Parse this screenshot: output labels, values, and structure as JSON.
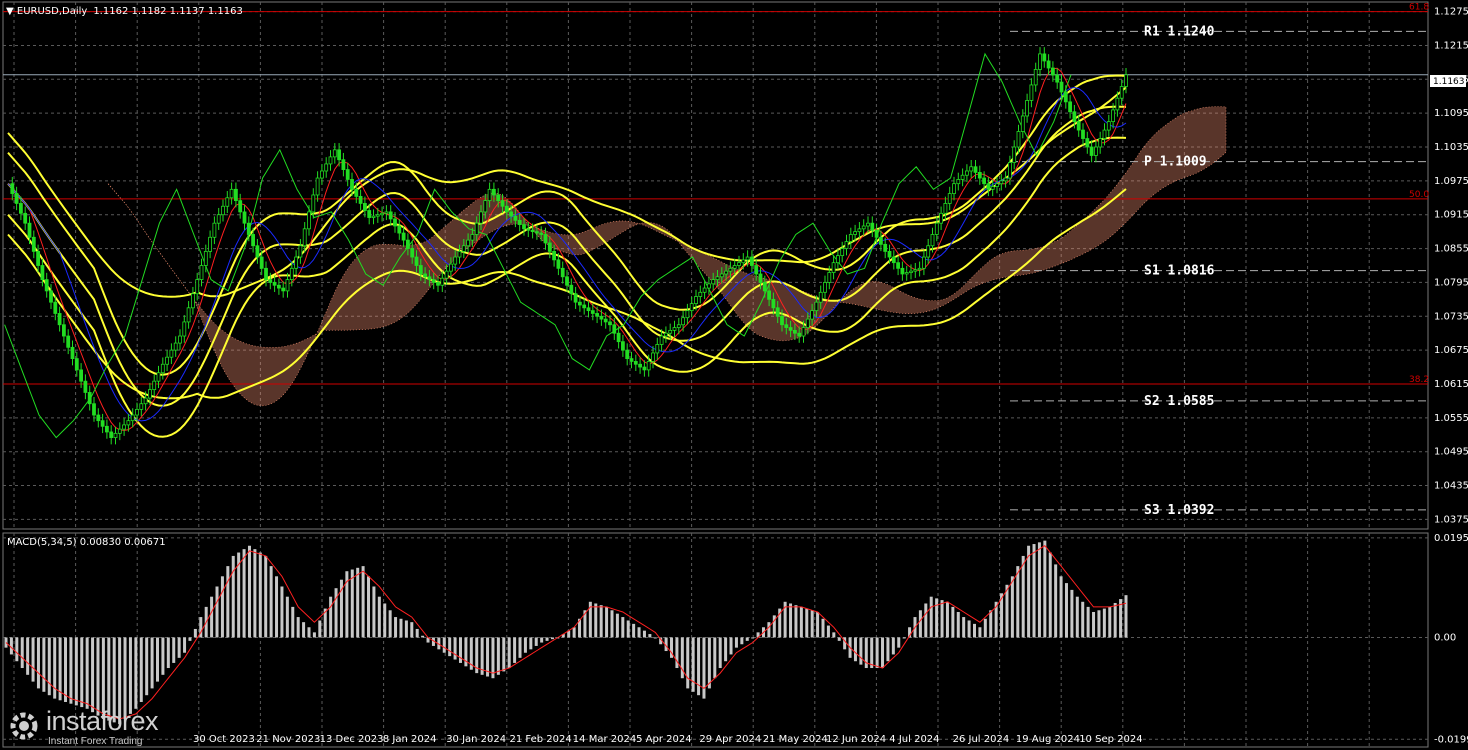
{
  "header": {
    "symbol": "EURUSD,Daily",
    "ohlc": "1.1162 1.1182 1.1137 1.1163",
    "current_price": "1.1163"
  },
  "macd": {
    "label": "MACD(5,34,5) 0.00830 0.00671"
  },
  "pivots": [
    {
      "label": "R1",
      "value": "1.1240"
    },
    {
      "label": "P",
      "value": "1.1009"
    },
    {
      "label": "S1",
      "value": "1.0816"
    },
    {
      "label": "S2",
      "value": "1.0585"
    },
    {
      "label": "S3",
      "value": "1.0392"
    }
  ],
  "fibo": [
    {
      "label": "61.8",
      "value": 1.1275
    },
    {
      "label": "50.0",
      "value": 1.0943
    },
    {
      "label": "38.2",
      "value": 1.0615
    }
  ],
  "logo": {
    "brand": "instaforex",
    "tagline": "Instant Forex Trading"
  },
  "colors": {
    "background": "#000000",
    "candles": "#22dd22",
    "bollinger": "#ffff33",
    "tenkan": "#ff2020",
    "kijun": "#1a2aff",
    "chikou": "#22dd22",
    "cloud": "#ff9977",
    "fibo_line": "#d00000",
    "macd_hist": "#c8c8c8",
    "macd_signal": "#ff2020",
    "grid": "#5a5a5a"
  },
  "chart_data": [
    {
      "type": "line",
      "title": "EURUSD,Daily",
      "y_ticks": [
        "1.1275",
        "1.1215",
        "1.1155",
        "1.1095",
        "1.1035",
        "1.0975",
        "1.0915",
        "1.0855",
        "1.0795",
        "1.0735",
        "1.0675",
        "1.0615",
        "1.0555",
        "1.0495",
        "1.0435",
        "1.0375"
      ],
      "x_ticks": [
        "30 Oct 2023",
        "21 Nov 2023",
        "13 Dec 2023",
        "8 Jan 2024",
        "30 Jan 2024",
        "21 Feb 2024",
        "14 Mar 2024",
        "5 Apr 2024",
        "29 Apr 2024",
        "21 May 2024",
        "12 Jun 2024",
        "4 Jul 2024",
        "26 Jul 2024",
        "19 Aug 2024",
        "10 Sep 2024"
      ],
      "ylim": [
        1.0358,
        1.1292
      ],
      "grid": true,
      "series": [
        {
          "name": "EURUSD",
          "values": [
            1.097,
            1.09,
            1.08,
            1.072,
            1.064,
            1.056,
            1.052,
            1.055,
            1.059,
            1.065,
            1.07,
            1.08,
            1.09,
            1.096,
            1.088,
            1.08,
            1.078,
            1.086,
            1.098,
            1.103,
            1.096,
            1.091,
            1.092,
            1.087,
            1.081,
            1.079,
            1.084,
            1.088,
            1.096,
            1.092,
            1.089,
            1.088,
            1.082,
            1.076,
            1.074,
            1.072,
            1.066,
            1.064,
            1.07,
            1.072,
            1.077,
            1.08,
            1.082,
            1.084,
            1.078,
            1.072,
            1.07,
            1.076,
            1.083,
            1.088,
            1.09,
            1.085,
            1.081,
            1.082,
            1.09,
            1.097,
            1.1,
            1.096,
            1.098,
            1.109,
            1.12,
            1.115,
            1.108,
            1.102,
            1.108,
            1.1163
          ]
        }
      ]
    },
    {
      "type": "bar",
      "title": "MACD(5,34,5) 0.00830 0.00671",
      "y_ticks": [
        "0.01955",
        "0.00",
        "-0.01998"
      ],
      "ylim": [
        -0.0215,
        0.0205
      ],
      "series": [
        {
          "name": "MACD",
          "values": [
            -0.002,
            -0.006,
            -0.01,
            -0.012,
            -0.013,
            -0.014,
            -0.016,
            -0.017,
            -0.014,
            -0.01,
            -0.006,
            -0.003,
            0.004,
            0.01,
            0.016,
            0.018,
            0.016,
            0.01,
            0.004,
            0.001,
            0.008,
            0.013,
            0.014,
            0.008,
            0.004,
            0.003,
            -0.001,
            -0.003,
            -0.005,
            -0.007,
            -0.008,
            -0.006,
            -0.003,
            -0.001,
            0.0,
            0.002,
            0.007,
            0.006,
            0.004,
            0.002,
            0.0,
            -0.004,
            -0.01,
            -0.012,
            -0.006,
            -0.002,
            0.0,
            0.003,
            0.007,
            0.006,
            0.005,
            0.001,
            -0.004,
            -0.006,
            -0.006,
            -0.002,
            0.004,
            0.008,
            0.007,
            0.004,
            0.002,
            0.007,
            0.012,
            0.018,
            0.019,
            0.012,
            0.008,
            0.005,
            0.006,
            0.0083
          ]
        },
        {
          "name": "Signal",
          "values": [
            -0.001,
            -0.004,
            -0.007,
            -0.01,
            -0.012,
            -0.013,
            -0.015,
            -0.016,
            -0.015,
            -0.012,
            -0.008,
            -0.004,
            0.001,
            0.007,
            0.013,
            0.017,
            0.016,
            0.012,
            0.006,
            0.003,
            0.006,
            0.011,
            0.013,
            0.01,
            0.006,
            0.004,
            0.0,
            -0.002,
            -0.004,
            -0.006,
            -0.007,
            -0.006,
            -0.004,
            -0.002,
            0.0,
            0.002,
            0.006,
            0.006,
            0.005,
            0.003,
            0.001,
            -0.003,
            -0.008,
            -0.01,
            -0.007,
            -0.003,
            -0.001,
            0.002,
            0.006,
            0.006,
            0.005,
            0.002,
            -0.002,
            -0.005,
            -0.006,
            -0.003,
            0.002,
            0.006,
            0.007,
            0.005,
            0.003,
            0.006,
            0.011,
            0.016,
            0.018,
            0.014,
            0.01,
            0.006,
            0.006,
            0.00671
          ]
        }
      ]
    }
  ]
}
